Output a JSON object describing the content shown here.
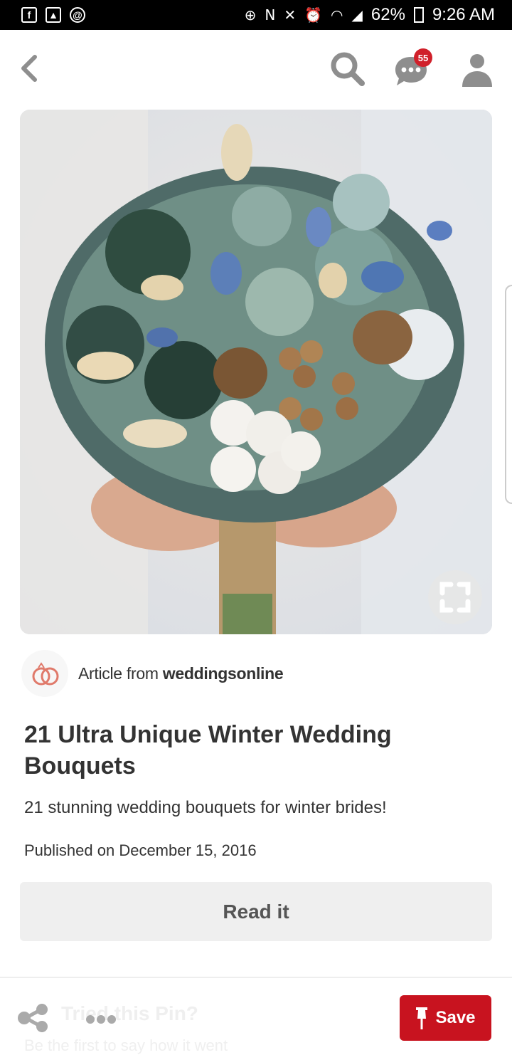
{
  "status_bar": {
    "battery": "62%",
    "time": "9:26 AM"
  },
  "topbar": {
    "notifications_badge": "55"
  },
  "pin": {
    "source_prefix": "Article from",
    "source_name": "weddingsonline",
    "title": "21 Ultra Unique Winter Wedding Bouquets",
    "description": "21 stunning wedding bouquets for winter brides!",
    "published": "Published on December 15, 2016",
    "read_button": "Read it"
  },
  "bottom_bar": {
    "prompt_title": "Tried this Pin?",
    "prompt_subtitle": "Be the first to say how it went",
    "save_label": "Save"
  },
  "colors": {
    "accent": "#c8131f",
    "badge": "#d0202a",
    "text": "#333333"
  },
  "icons": [
    "back-icon",
    "search-icon",
    "message-icon",
    "profile-icon",
    "expand-icon",
    "wedding-rings-icon",
    "share-icon",
    "more-icon",
    "pin-icon"
  ]
}
